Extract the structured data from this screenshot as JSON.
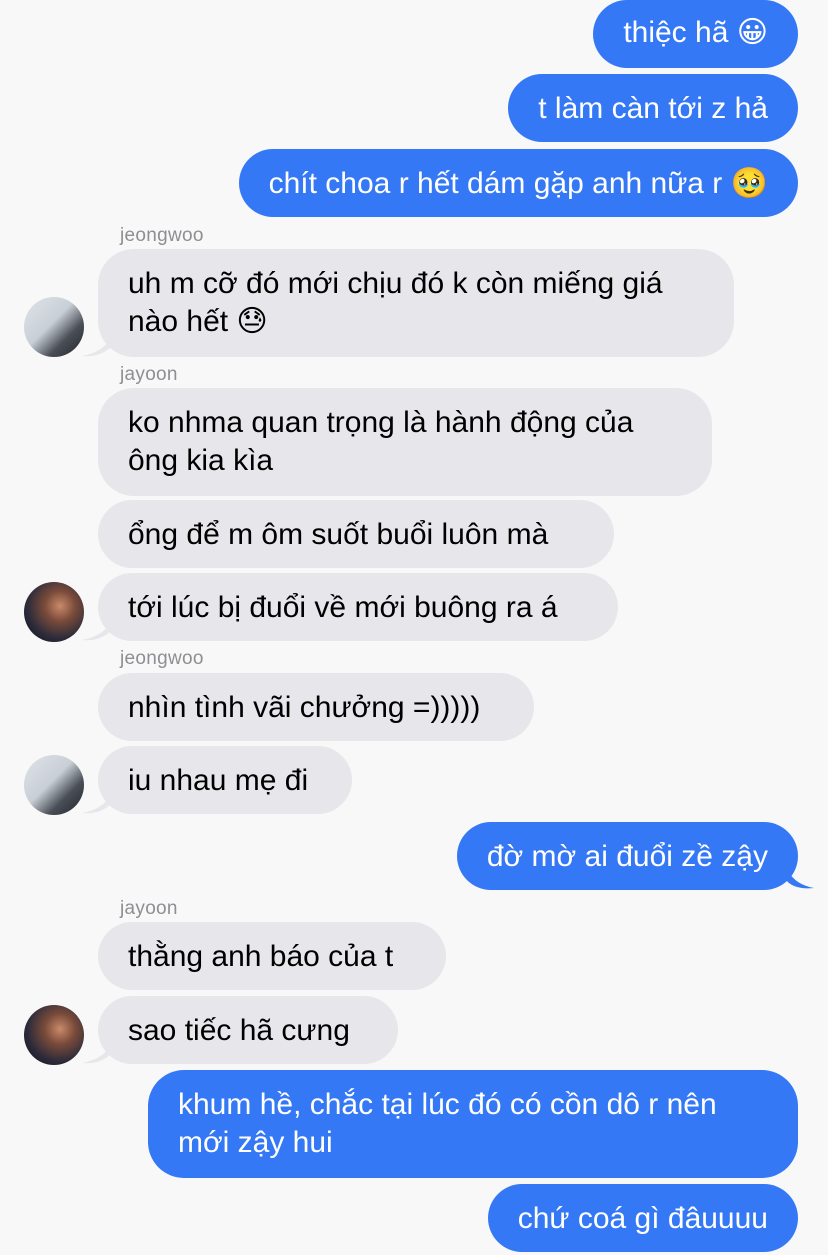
{
  "colors": {
    "outgoing": "#3478f6",
    "incoming": "#e7e7eb",
    "background": "#f8f8f8",
    "sender_name": "#8e8e93"
  },
  "senders": {
    "jeongwoo": "jeongwoo",
    "jayoon": "jayoon"
  },
  "messages": [
    {
      "dir": "out",
      "text": "thiệc hã 😀"
    },
    {
      "dir": "out",
      "text": "t làm càn tới z hả"
    },
    {
      "dir": "out",
      "text": "chít choa r hết dám gặp anh nữa r 🥹"
    },
    {
      "dir": "in",
      "sender": "jeongwoo",
      "text": "uh m cỡ đó mới chịu đó k còn miếng giá\nnào hết 😓"
    },
    {
      "dir": "in",
      "sender": "jayoon",
      "text": "ko nhma quan trọng là hành động của\nông kia kìa"
    },
    {
      "dir": "in",
      "sender": "jayoon",
      "text": "ổng để m ôm suốt buổi luôn mà"
    },
    {
      "dir": "in",
      "sender": "jayoon",
      "text": "tới lúc bị đuổi về mới buông ra á"
    },
    {
      "dir": "in",
      "sender": "jeongwoo",
      "text": "nhìn tình vãi chưởng =)))))"
    },
    {
      "dir": "in",
      "sender": "jeongwoo",
      "text": "iu nhau mẹ đi"
    },
    {
      "dir": "out",
      "text": "đờ mờ ai đuổi zề zậy"
    },
    {
      "dir": "in",
      "sender": "jayoon",
      "text": "thằng anh báo của t"
    },
    {
      "dir": "in",
      "sender": "jayoon",
      "text": "sao tiếc hã cưng"
    },
    {
      "dir": "out",
      "text": "khum hề, chắc tại lúc đó có cồn dô r nên\nmới zậy hui"
    },
    {
      "dir": "out",
      "text": "chứ coá gì đâuuuu"
    }
  ]
}
